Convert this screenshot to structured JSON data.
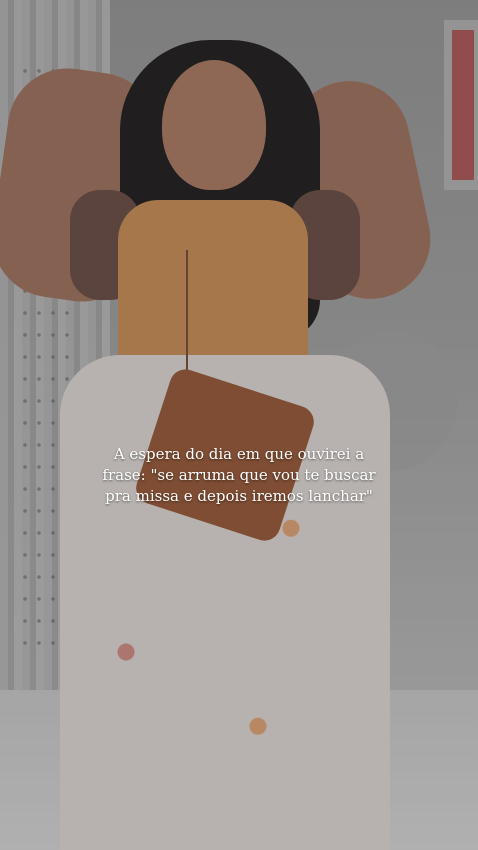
{
  "caption": {
    "line1": "A espera do dia em que ouvirei a",
    "line2": "frase: \"se arruma que vou te buscar",
    "line3": "pra missa e depois iremos lanchar\""
  }
}
